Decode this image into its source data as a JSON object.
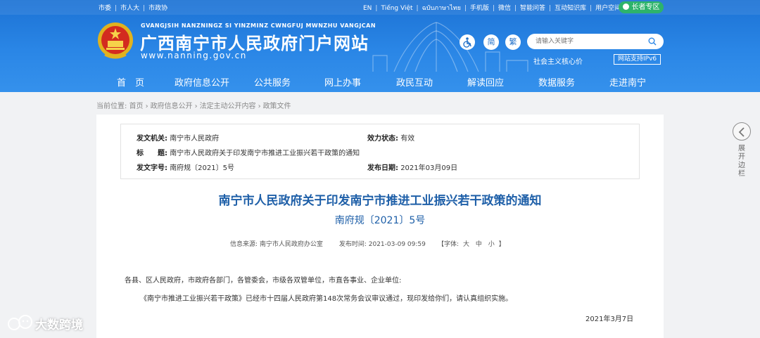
{
  "topbar": {
    "left_links": [
      "市委",
      "市人大",
      "市政协"
    ],
    "right_links": [
      "EN",
      "Tiếng Việt",
      "ฉบับภาษาไทย",
      "手机版",
      "微信",
      "智能问答",
      "互动知识库",
      "用户空间"
    ],
    "elder_mode": "长者专区"
  },
  "site": {
    "pinyin": "GVANGJSIH NANZNINGZ SI YINZMINZ CWNGFUJ MWNZHU VANGJCAN",
    "title": "广西南宁市人民政府门户网站",
    "url": "www.nanning.gov.cn"
  },
  "tools": {
    "accessibility_icon": "wheelchair-icon",
    "simplified": "简",
    "traditional": "繁",
    "search_placeholder": "请输入关键字",
    "values_text": "社会主义核心价",
    "ipv6": "网站支持IPv6"
  },
  "nav": [
    "首　页",
    "政府信息公开",
    "公共服务",
    "网上办事",
    "政民互动",
    "解读回应",
    "数据服务",
    "走进南宁"
  ],
  "breadcrumb": {
    "prefix": "当前位置:",
    "items": [
      "首页",
      "政府信息公开",
      "法定主动公开内容",
      "政策文件"
    ]
  },
  "meta": {
    "issuer_label": "发文机关:",
    "issuer": "南宁市人民政府",
    "status_label": "效力状态:",
    "status": "有效",
    "title_label": "标　　题:",
    "title": "南宁市人民政府关于印发南宁市推进工业振兴若干政策的通知",
    "doc_no_label": "发文字号:",
    "doc_no": "南府规〔2021〕5号",
    "date_label": "发布日期:",
    "date": "2021年03月09日"
  },
  "document": {
    "heading": "南宁市人民政府关于印发南宁市推进工业振兴若干政策的通知",
    "number": "南府规〔2021〕5号",
    "source_label": "信息来源:",
    "source": "南宁市人民政府办公室",
    "publish_label": "发布时间:",
    "publish_time": "2021-03-09 09:59",
    "font_label": "【字体:",
    "font_large": "大",
    "font_medium": "中",
    "font_small": "小",
    "font_close": "】",
    "salutation": "各县、区人民政府，市政府各部门，各管委会，市级各双管单位，市直各事业、企业单位:",
    "paragraph1": "《南宁市推进工业振兴若干政策》已经市十四届人民政府第148次常务会议审议通过，现印发给你们，请认真组织实施。",
    "signed_date": "2021年3月7日"
  },
  "side": {
    "icon": "chevron-left-icon",
    "label": [
      "展",
      "开",
      "边",
      "栏"
    ]
  },
  "watermark": {
    "text": "大数跨境"
  },
  "colors": {
    "header_blue": "#2a86e6",
    "title_blue": "#1e5fa8",
    "elder_green": "#2db36b"
  }
}
